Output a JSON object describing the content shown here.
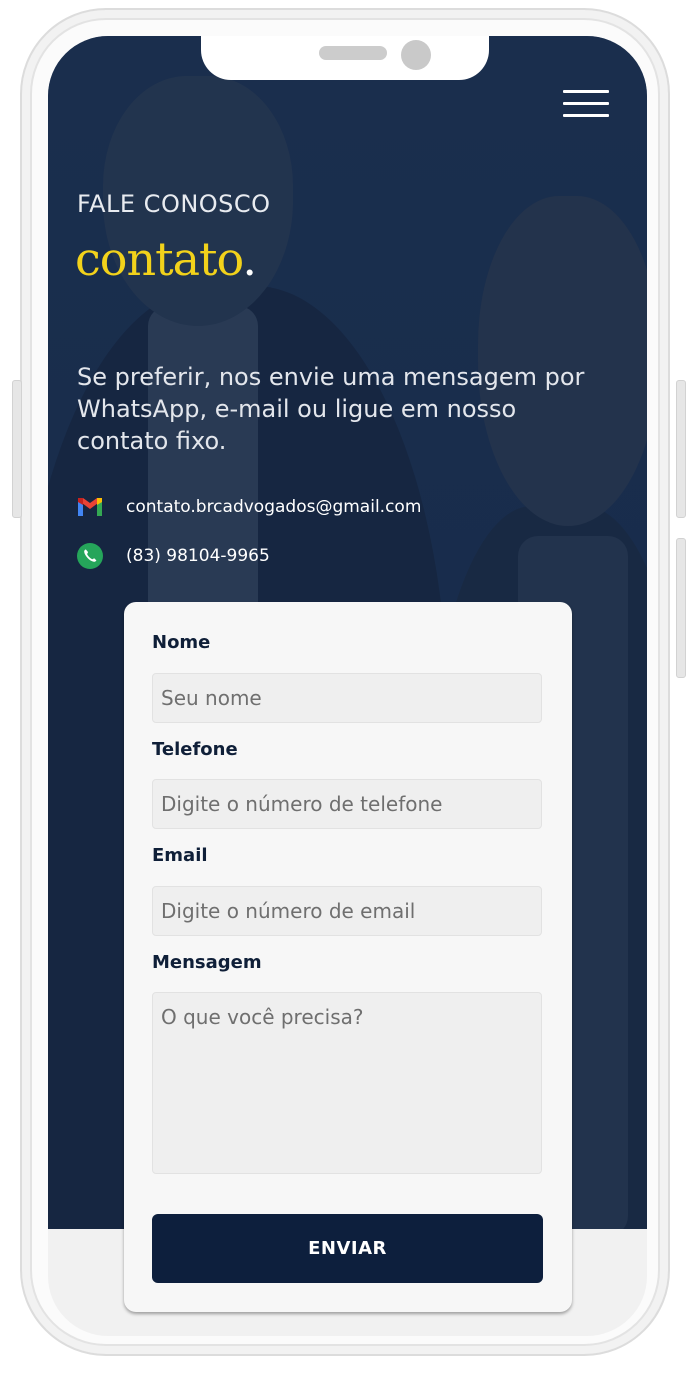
{
  "header": {
    "menu_icon": "hamburger-menu-icon"
  },
  "hero": {
    "eyebrow": "FALE CONOSCO",
    "title": "contato",
    "title_dot": ".",
    "intro": "Se preferir, nos envie uma mensagem por WhatsApp, e-mail ou ligue em nosso contato fixo."
  },
  "contacts": {
    "email": {
      "icon": "gmail-icon",
      "text": "contato.brcadvogados@gmail.com"
    },
    "phone": {
      "icon": "phone-icon",
      "text": "(83) 98104-9965"
    }
  },
  "form": {
    "name_label": "Nome",
    "name_placeholder": "Seu nome",
    "phone_label": "Telefone",
    "phone_placeholder": "Digite o número de telefone",
    "email_label": "Email",
    "email_placeholder": "Digite o número de email",
    "message_label": "Mensagem",
    "message_placeholder": "O que você precisa?",
    "submit_label": "ENVIAR"
  },
  "colors": {
    "brand_navy": "#0d1f3d",
    "accent_yellow": "#f2d21b",
    "whatsapp_green": "#25a55a"
  }
}
